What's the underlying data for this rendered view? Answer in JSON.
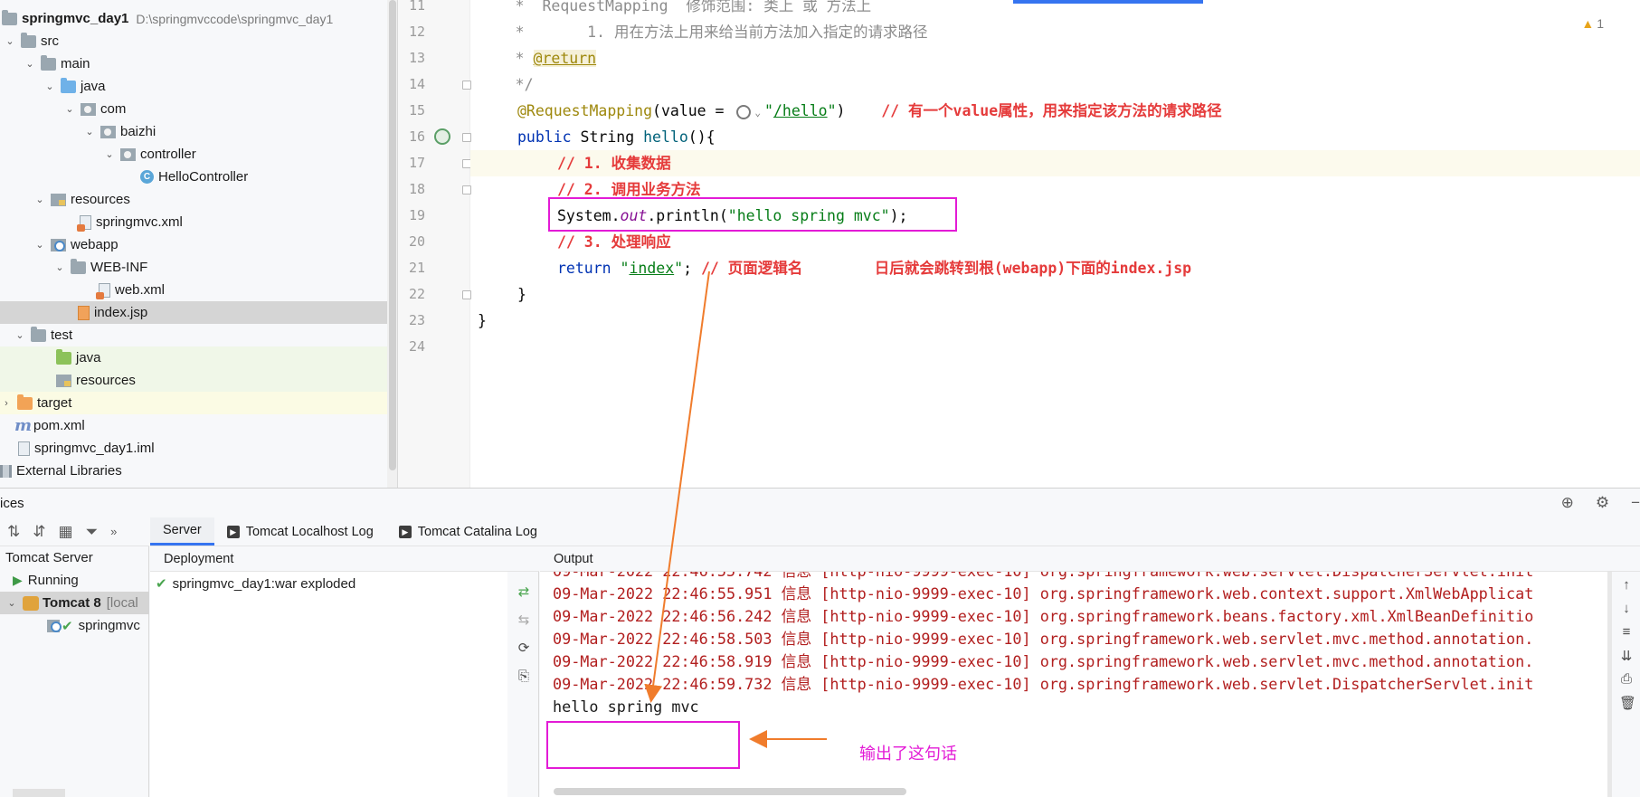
{
  "project_tree": {
    "root": {
      "label": "springmvc_day1",
      "path": "D:\\springmvccode\\springmvc_day1"
    },
    "items": [
      {
        "label": "src"
      },
      {
        "label": "main"
      },
      {
        "label": "java"
      },
      {
        "label": "com"
      },
      {
        "label": "baizhi"
      },
      {
        "label": "controller"
      },
      {
        "label": "HelloController"
      },
      {
        "label": "resources"
      },
      {
        "label": "springmvc.xml"
      },
      {
        "label": "webapp"
      },
      {
        "label": "WEB-INF"
      },
      {
        "label": "web.xml"
      },
      {
        "label": "index.jsp"
      },
      {
        "label": "test"
      },
      {
        "label": "java"
      },
      {
        "label": "resources"
      },
      {
        "label": "target"
      },
      {
        "label": "pom.xml"
      },
      {
        "label": "springmvc_day1.iml"
      },
      {
        "label": "External Libraries"
      }
    ]
  },
  "editor": {
    "warning_count": "1",
    "line_numbers": [
      "11",
      "12",
      "13",
      "14",
      "15",
      "16",
      "17",
      "18",
      "19",
      "20",
      "21",
      "22",
      "23",
      "24"
    ],
    "lines": {
      "l11": "     *  RequestMapping  修饰范围: 类上 或 方法上",
      "l12_a": "     *       1. 用在方法上用来给当前方法加入指定的请求路径",
      "l13_a": "     * ",
      "l13_tag": "@return",
      "l14": "     */",
      "l15_ann": "@RequestMapping",
      "l15_mid": "(value = ",
      "l15_q1": "\"",
      "l15_path": "/hello",
      "l15_q2": "\"",
      "l15_end": ")    ",
      "l15_cmt": "// 有一个value属性，用来指定该方法的请求路径",
      "l16_kw": "public ",
      "l16_type": "String ",
      "l16_fn": "hello",
      "l16_end": "(){",
      "l17": "// 1. 收集数据",
      "l18": "// 2. 调用业务方法",
      "l19_a": "System.",
      "l19_field": "out",
      "l19_b": ".println(",
      "l19_str": "\"hello spring mvc\"",
      "l19_c": ");",
      "l20": "// 3. 处理响应",
      "l21_kw": "return ",
      "l21_q1": "\"",
      "l21_str": "index",
      "l21_q2": "\"",
      "l21_semi": "; ",
      "l21_cmt": "// 页面逻辑名        日后就会跳转到根(webapp)下面的index.jsp",
      "l22": "}",
      "l23": "}"
    }
  },
  "services": {
    "title": "ices",
    "tree": {
      "server_group": "Tomcat Server",
      "running": "Running",
      "tomcat": "Tomcat 8",
      "tomcat_suffix": "[local",
      "artifact": "springmvc"
    },
    "tabs": [
      "Server",
      "Tomcat Localhost Log",
      "Tomcat Catalina Log"
    ],
    "deployment_header": "Deployment",
    "deployment_item": "springmvc_day1:war exploded",
    "output_header": "Output",
    "log_lines": [
      "09-Mar-2022 22:46:55.742 信息 [http-nio-9999-exec-10] org.springframework.web.servlet.DispatcherServlet.init",
      "09-Mar-2022 22:46:55.951 信息 [http-nio-9999-exec-10] org.springframework.web.context.support.XmlWebApplicat",
      "09-Mar-2022 22:46:56.242 信息 [http-nio-9999-exec-10] org.springframework.beans.factory.xml.XmlBeanDefinitio",
      "09-Mar-2022 22:46:58.503 信息 [http-nio-9999-exec-10] org.springframework.web.servlet.mvc.method.annotation.",
      "09-Mar-2022 22:46:58.919 信息 [http-nio-9999-exec-10] org.springframework.web.servlet.mvc.method.annotation.",
      "09-Mar-2022 22:46:59.732 信息 [http-nio-9999-exec-10] org.springframework.web.servlet.DispatcherServlet.init"
    ],
    "output_line": "hello spring mvc"
  },
  "annotation": {
    "text": "输出了这句话",
    "color_box": "#e31bd6",
    "color_arrow": "#f07c2c"
  }
}
